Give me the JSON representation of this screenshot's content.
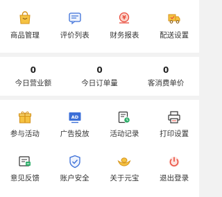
{
  "shortcuts": [
    {
      "label": "商品管理",
      "icon": "shopping-bag-icon"
    },
    {
      "label": "评价列表",
      "icon": "comment-list-icon"
    },
    {
      "label": "财务报表",
      "icon": "finance-coin-icon"
    },
    {
      "label": "配送设置",
      "icon": "delivery-truck-icon"
    }
  ],
  "stats": [
    {
      "value": "0",
      "label": "今日营业额"
    },
    {
      "value": "0",
      "label": "今日订单量"
    },
    {
      "value": "0",
      "label": "客消费单价"
    }
  ],
  "tools": [
    {
      "label": "参与活动",
      "icon": "gift-box-icon"
    },
    {
      "label": "广告投放",
      "icon": "ad-screen-icon"
    },
    {
      "label": "活动记录",
      "icon": "activity-record-icon"
    },
    {
      "label": "打印设置",
      "icon": "printer-icon"
    },
    {
      "label": "意见反馈",
      "icon": "feedback-icon"
    },
    {
      "label": "账户安全",
      "icon": "shield-icon"
    },
    {
      "label": "关于元宝",
      "icon": "gold-ingot-icon"
    },
    {
      "label": "退出登录",
      "icon": "power-icon"
    }
  ],
  "colors": {
    "accent_orange": "#f5a623",
    "accent_blue": "#3b6fd8",
    "accent_red": "#e94b3c",
    "background": "#f2f2f2",
    "card": "#ffffff"
  }
}
